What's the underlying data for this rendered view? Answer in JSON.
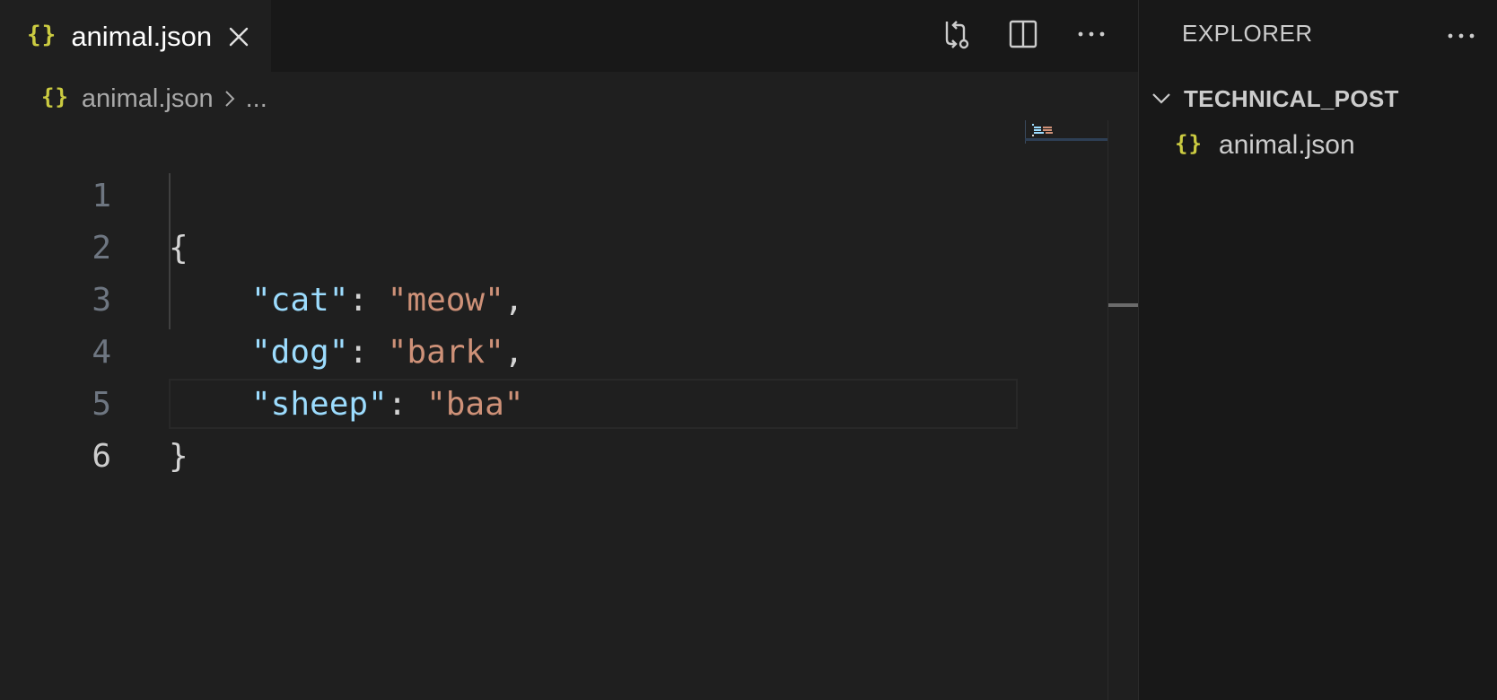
{
  "tab": {
    "icon": "json-braces-icon",
    "icon_glyph": "{}",
    "label": "animal.json"
  },
  "editor_actions": [
    {
      "icon": "git-compare-icon"
    },
    {
      "icon": "split-editor-icon"
    },
    {
      "icon": "more-actions-icon"
    }
  ],
  "breadcrumb": {
    "icon_glyph": "{}",
    "file": "animal.json",
    "ellipsis": "..."
  },
  "code": {
    "line_numbers": [
      "1",
      "2",
      "3",
      "4",
      "5",
      "6"
    ],
    "active_line": "6",
    "lines": [
      {
        "open": "{"
      },
      {
        "key": "\"cat\"",
        "colon": ": ",
        "value": "\"meow\"",
        "comma": ","
      },
      {
        "key": "\"dog\"",
        "colon": ": ",
        "value": "\"bark\"",
        "comma": ","
      },
      {
        "key": "\"sheep\"",
        "colon": ": ",
        "value": "\"baa\"",
        "comma": ""
      },
      {
        "close": "}"
      },
      {}
    ]
  },
  "sidebar": {
    "title": "EXPLORER",
    "folder": "TECHNICAL_POST",
    "files": [
      {
        "icon_glyph": "{}",
        "name": "animal.json"
      }
    ]
  },
  "colors": {
    "editor_bg": "#1f1f1f",
    "sidebar_bg": "#181818",
    "json_icon": "#cbcb41",
    "json_key": "#9cdcfe",
    "json_string": "#ce9178"
  }
}
